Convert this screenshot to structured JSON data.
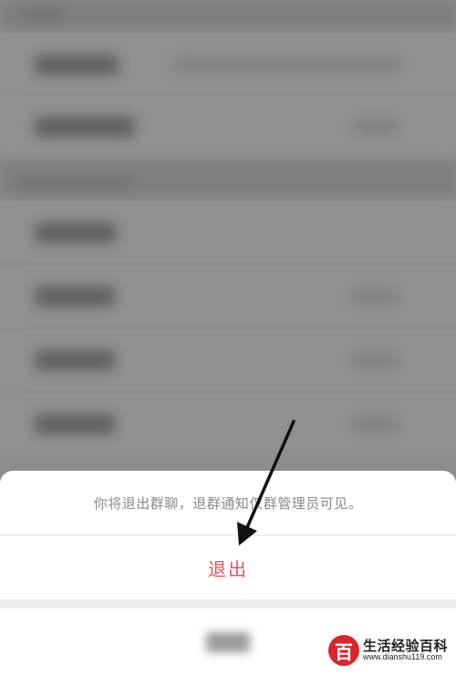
{
  "background": {
    "description_hidden": true
  },
  "action_sheet": {
    "message": "你将退出群聊，退群通知仅群管理员可见。",
    "exit_label": "退出",
    "exit_color": "#e0535d",
    "cancel_label": ""
  },
  "annotation": {
    "type": "arrow",
    "color": "#111111"
  },
  "watermark": {
    "logo_char": "百",
    "title": "生活经验百科",
    "url": "www.dianshu119.com",
    "brand_color": "#d9272e"
  }
}
